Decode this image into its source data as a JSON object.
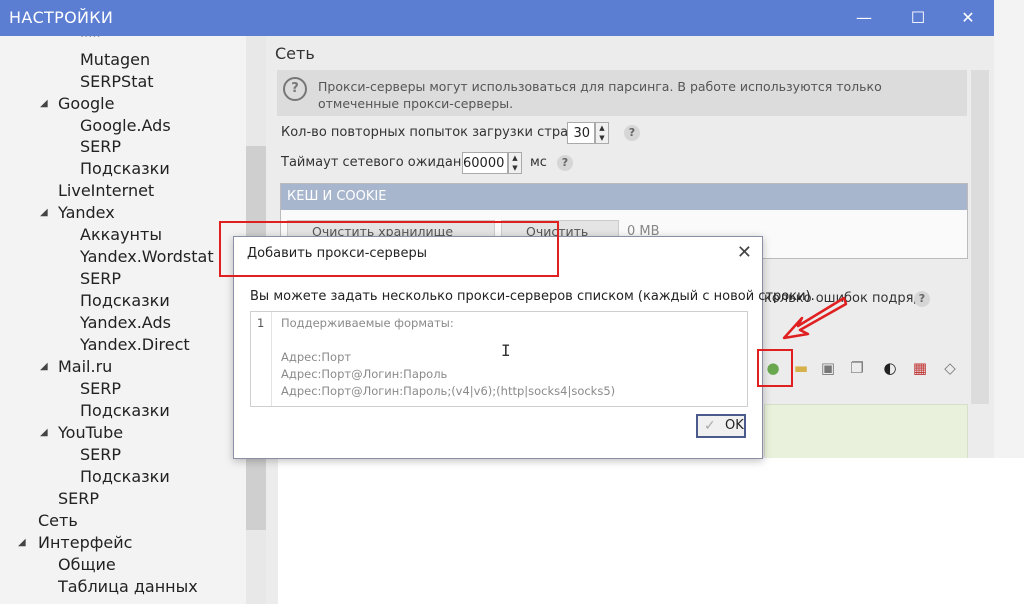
{
  "window": {
    "title": "НАСТРОЙКИ",
    "controls": {
      "minimize": "—",
      "maximize": "☐",
      "close": "✕"
    }
  },
  "tree": {
    "items": [
      {
        "label": "Mutagen",
        "indent": 2
      },
      {
        "label": "SERPStat",
        "indent": 2
      },
      {
        "label": "Google",
        "indent": 1,
        "expanded": true
      },
      {
        "label": "Google.Ads",
        "indent": 2
      },
      {
        "label": "SERP",
        "indent": 2
      },
      {
        "label": "Подсказки",
        "indent": 2
      },
      {
        "label": "LiveInternet",
        "indent": 1
      },
      {
        "label": "Yandex",
        "indent": 1,
        "expanded": true
      },
      {
        "label": "Аккаунты",
        "indent": 2
      },
      {
        "label": "Yandex.Wordstat",
        "indent": 2
      },
      {
        "label": "SERP",
        "indent": 2
      },
      {
        "label": "Подсказки",
        "indent": 2
      },
      {
        "label": "Yandex.Ads",
        "indent": 2
      },
      {
        "label": "Yandex.Direct",
        "indent": 2
      },
      {
        "label": "Mail.ru",
        "indent": 1,
        "expanded": true
      },
      {
        "label": "SERP",
        "indent": 2
      },
      {
        "label": "Подсказки",
        "indent": 2
      },
      {
        "label": "YouTube",
        "indent": 1,
        "expanded": true
      },
      {
        "label": "SERP",
        "indent": 2
      },
      {
        "label": "Подсказки",
        "indent": 2
      },
      {
        "label": "SERP",
        "indent": 1
      },
      {
        "label": "Сеть",
        "indent": 0
      },
      {
        "label": "Интерфейс",
        "indent": 0,
        "expanded": true
      },
      {
        "label": "Общие",
        "indent": 1
      },
      {
        "label": "Таблица данных",
        "indent": 1
      }
    ]
  },
  "section": {
    "title": "Сеть",
    "info": "Прокси-серверы могут использоваться для парсинга. В работе используются только отмеченные прокси-серверы.",
    "retries_label": "Кол-во повторных попыток загрузки страниц:",
    "retries_value": "30",
    "timeout_label": "Таймаут сетевого ожидания:",
    "timeout_value": "60000",
    "timeout_unit": "мс",
    "help": "?"
  },
  "cache": {
    "header": "КЕШ И COOKIE",
    "clear_cookie": "Очистить хранилище cookie",
    "clear_cache": "Очистить кеш",
    "size": "0 MB"
  },
  "behind": {
    "errors_text": "колько ошибок подряд"
  },
  "dialog": {
    "title": "Добавить прокси-серверы",
    "close": "✕",
    "description": "Вы можете задать несколько прокси-серверов списком (каждый с новой строки).",
    "line_number": "1",
    "placeholder_lines": [
      "Поддерживаемые форматы:",
      "",
      "Адрес:Порт",
      "Адрес:Порт@Логин:Пароль",
      "Адрес:Порт@Логин:Пароль;(v4|v6);(http|socks4|socks5)"
    ],
    "ok": "OK"
  },
  "colors": {
    "titlebar": "#5b7ed3",
    "annotation": "#e02020",
    "cache_header": "#a8b6cd"
  }
}
